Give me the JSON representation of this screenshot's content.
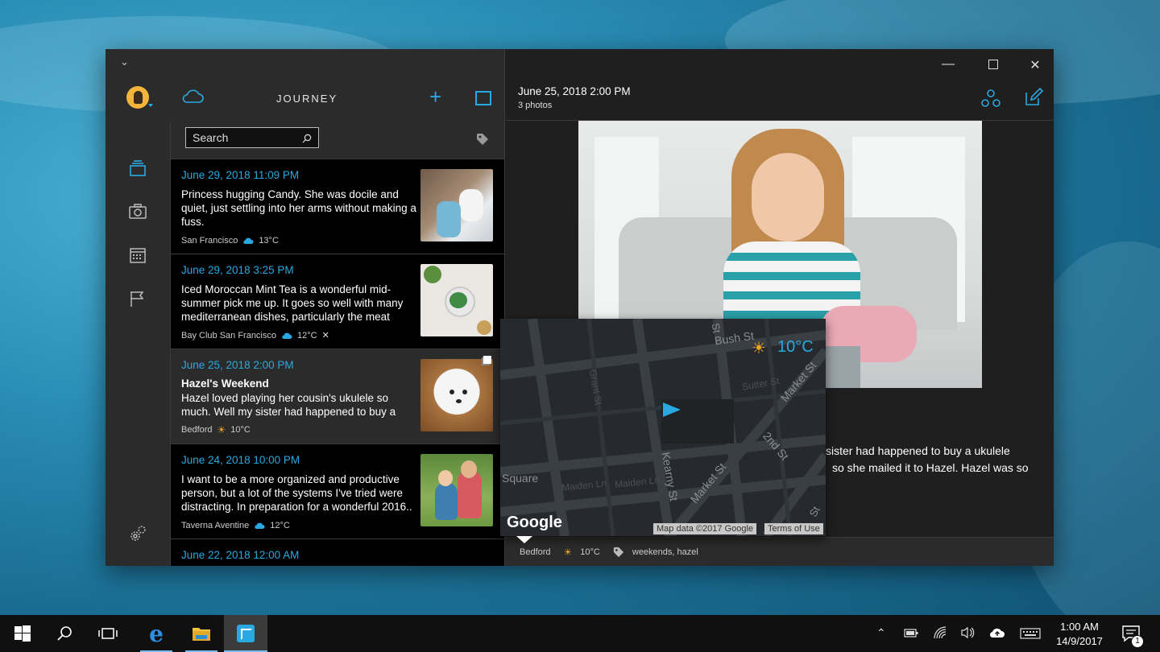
{
  "app": {
    "title": "JOURNEY"
  },
  "search": {
    "placeholder": "Search"
  },
  "entries": [
    {
      "date": "June 29, 2018 11:09 PM",
      "title": "",
      "text": "Princess hugging Candy. She was docile and quiet, just settling into her arms without making a fuss.",
      "location": "San Francisco",
      "temp": "13°C",
      "weather_icon": "cloud-icon",
      "extra_icon": ""
    },
    {
      "date": "June 29, 2018 3:25 PM",
      "title": "",
      "text": "Iced Moroccan Mint Tea is a wonderful mid-summer pick me up. It goes so well with many mediterranean dishes, particularly the meat",
      "location": "Bay Club San Francisco",
      "temp": "12°C",
      "weather_icon": "cloud-icon",
      "extra_icon": "utensils-icon"
    },
    {
      "date": "June 25, 2018 2:00 PM",
      "title": "Hazel's Weekend",
      "text": "Hazel loved playing her cousin's ukulele so much. Well my sister had happened to buy a",
      "location": "Bedford",
      "temp": "10°C",
      "weather_icon": "sun-icon",
      "extra_icon": ""
    },
    {
      "date": "June 24, 2018 10:00 PM",
      "title": "",
      "text": "I want to be a more organized and productive person, but a lot of the systems I've tried were distracting. In preparation for a wonderful 2016..",
      "location": "Taverna Aventine",
      "temp": "12°C",
      "weather_icon": "cloud-icon",
      "extra_icon": ""
    },
    {
      "date": "June 22, 2018 12:00 AM",
      "title": "",
      "text": "",
      "location": "",
      "temp": "",
      "weather_icon": "",
      "extra_icon": ""
    }
  ],
  "detail": {
    "date": "June 25, 2018 2:00 PM",
    "photo_count": "3 photos",
    "body_line1": "sister had happened to buy a ukulele",
    "body_line2": "so she mailed it to Hazel. Hazel was so",
    "footer_location": "Bedford",
    "footer_temp": "10°C",
    "footer_tags": "weekends, hazel"
  },
  "map": {
    "temp": "10°C",
    "brand": "Google",
    "attribution": "Map data ©2017 Google",
    "terms": "Terms of Use",
    "streets": [
      "Bush St",
      "Market St",
      "2nd St",
      "Kearny St",
      "Market St",
      "Square",
      "Sutter St",
      "Maiden Ln",
      "Maiden Ln",
      "Grant St",
      "St",
      "St"
    ]
  },
  "taskbar": {
    "time": "1:00 AM",
    "date": "14/9/2017",
    "notification_count": "1"
  },
  "colors": {
    "accent": "#29a9e1",
    "sun": "#f5a623"
  }
}
